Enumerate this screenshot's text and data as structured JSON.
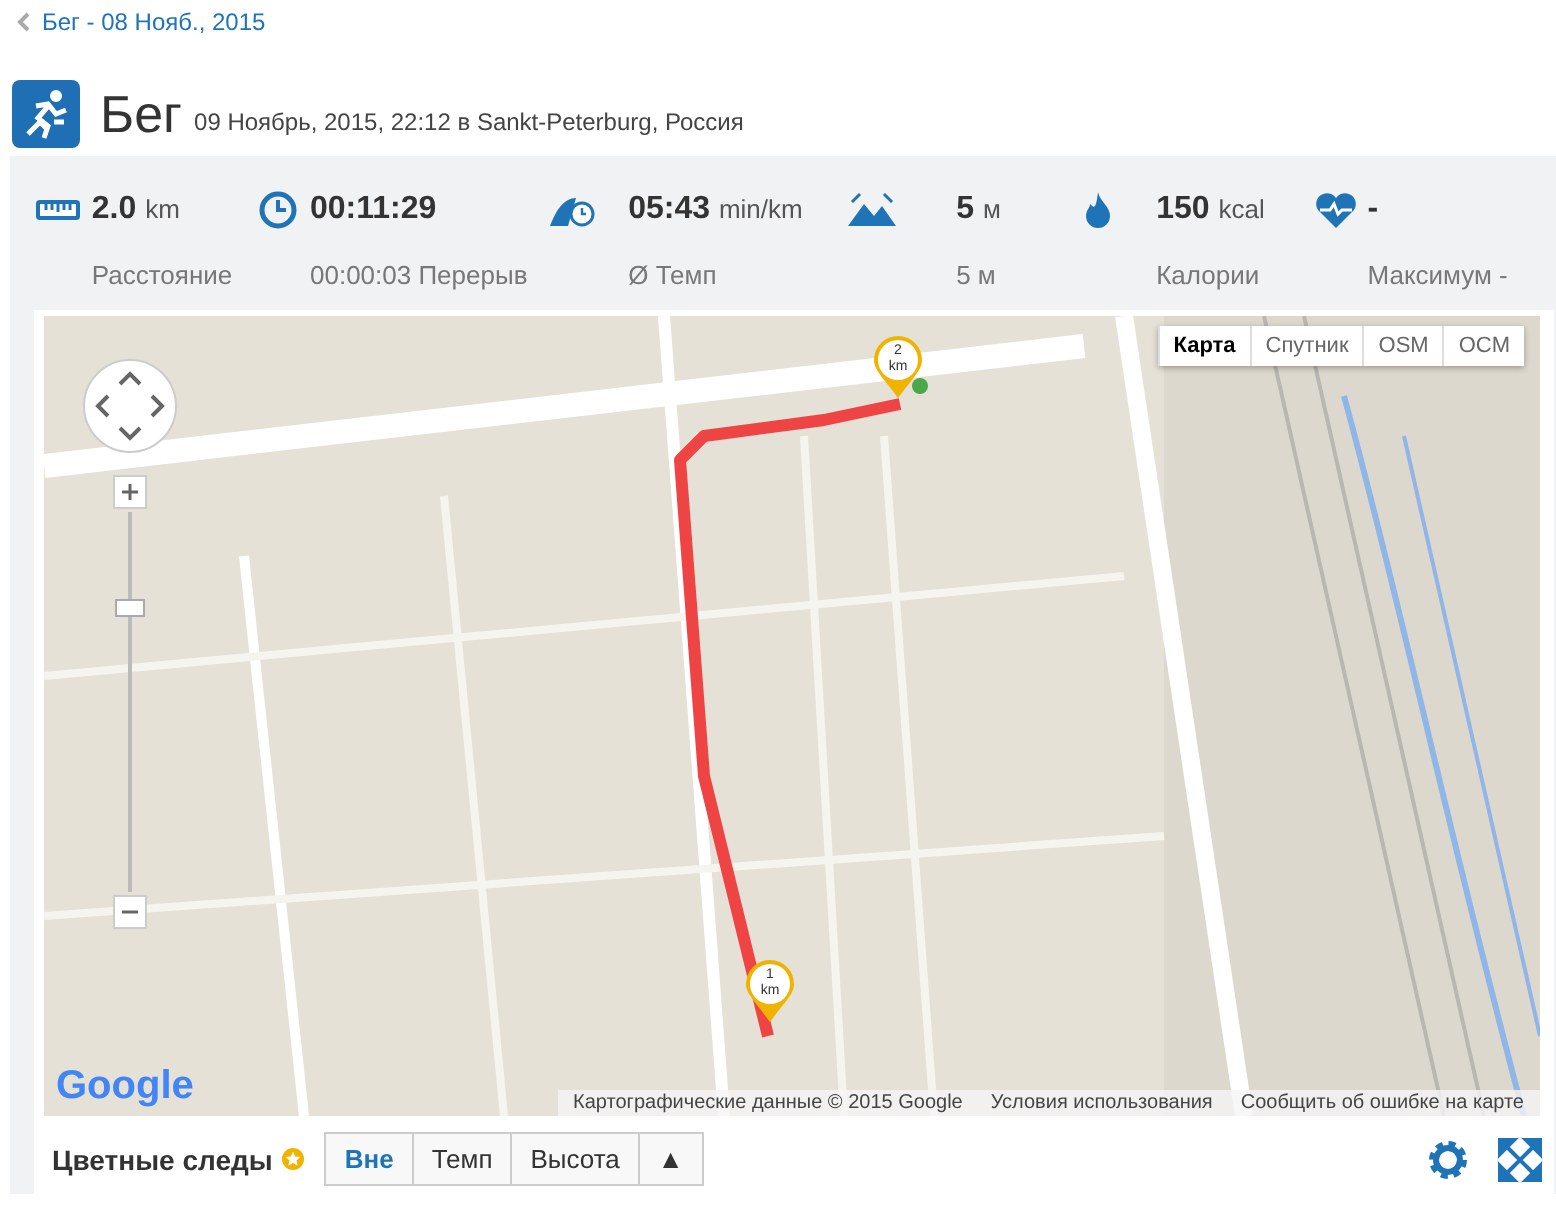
{
  "breadcrumb": {
    "label": "Бег - 08 Нояб., 2015"
  },
  "header": {
    "title": "Бег",
    "subtitle": "09 Ноябрь, 2015, 22:12 в Sankt-Peterburg, Россия"
  },
  "stats": [
    {
      "kind": "distance",
      "value": "2.0",
      "unit": "km",
      "label": "Расстояние"
    },
    {
      "kind": "duration",
      "value": "00:11:29",
      "label": "00:00:03 Перерыв"
    },
    {
      "kind": "pace",
      "value": "05:43",
      "unit": "min/km",
      "label": "Ø Темп"
    },
    {
      "kind": "elevation",
      "value": "5",
      "unit": "м",
      "label": "5 м"
    },
    {
      "kind": "calories",
      "value": "150",
      "unit": "kcal",
      "label": "Калории"
    },
    {
      "kind": "heart",
      "value": "-",
      "label": "Максимум -"
    }
  ],
  "map": {
    "types": [
      {
        "label": "Карта",
        "selected": true
      },
      {
        "label": "Спутник",
        "selected": false
      },
      {
        "label": "OSM",
        "selected": false
      },
      {
        "label": "OCM",
        "selected": false
      }
    ],
    "markers": [
      {
        "number": "2",
        "unit": "km"
      },
      {
        "number": "1",
        "unit": "km"
      }
    ],
    "logo": "Google",
    "attribution": [
      "Картографические данные © 2015 Google",
      "Условия использования",
      "Сообщить об ошибке на карте"
    ]
  },
  "footer": {
    "title": "Цветные следы",
    "modes": [
      {
        "label": "Вне",
        "selected": true
      },
      {
        "label": "Темп",
        "selected": false
      },
      {
        "label": "Высота",
        "selected": false
      },
      {
        "label": "▲",
        "selected": false
      }
    ]
  }
}
